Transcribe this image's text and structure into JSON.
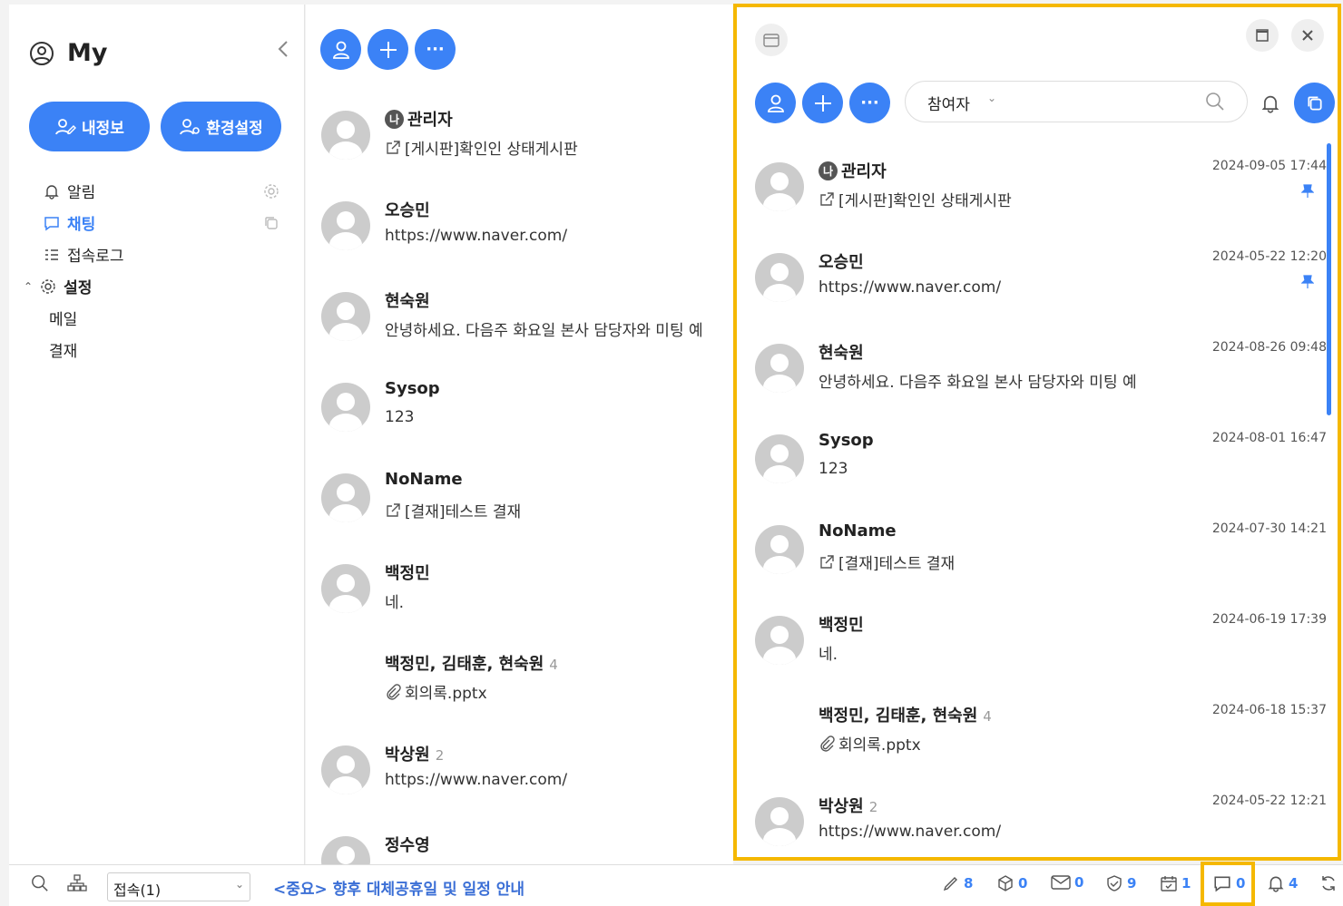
{
  "sidebar": {
    "title": "My",
    "buttons": {
      "myinfo": "내정보",
      "settings": "환경설정"
    },
    "menu": {
      "alarm": "알림",
      "chat": "채팅",
      "accesslog": "접속로그",
      "settings": "설정",
      "mail": "메일",
      "approval": "결재"
    }
  },
  "chats": [
    {
      "name": "관리자",
      "badge": "나",
      "msg": "[게시판]확인인 상태게시판",
      "icon": "external-link",
      "time": "2024-09-05 17:44",
      "pinned": true,
      "avatar": true
    },
    {
      "name": "오승민",
      "msg": "https://www.naver.com/",
      "time": "2024-05-22 12:20",
      "pinned": true,
      "avatar": true
    },
    {
      "name": "현숙원",
      "msg": "안녕하세요. 다음주 화요일 본사 담당자와 미팅 예",
      "time": "2024-08-26 09:48",
      "avatar": true
    },
    {
      "name": "Sysop",
      "msg": "123",
      "time": "2024-08-01 16:47",
      "avatar": true
    },
    {
      "name": "NoName",
      "msg": "[결재]테스트 결재",
      "icon": "external-link",
      "time": "2024-07-30 14:21",
      "avatar": true
    },
    {
      "name": "백정민",
      "msg": "네.",
      "time": "2024-06-19 17:39",
      "avatar": true
    },
    {
      "name": "백정민, 김태훈, 현숙원",
      "count": "4",
      "msg": "회의록.pptx",
      "icon": "paperclip",
      "time": "2024-06-18 15:37",
      "avatar": false
    },
    {
      "name": "박상원",
      "count": "2",
      "msg": "https://www.naver.com/",
      "time": "2024-05-22 12:21",
      "avatar": true
    },
    {
      "name": "정수영",
      "msg": "",
      "time": "",
      "avatar": true
    }
  ],
  "panel": {
    "filter": "참여자"
  },
  "bottom": {
    "select": "접속(1)",
    "notice": "<중요> 향후 대체공휴일 및 일정 안내",
    "counts": {
      "sign": "8",
      "box": "0",
      "mail": "0",
      "shield": "9",
      "calendar": "1",
      "chat": "0",
      "bell": "4"
    }
  },
  "colors": {
    "accent": "#3b82f6",
    "highlight": "#f5b800"
  }
}
